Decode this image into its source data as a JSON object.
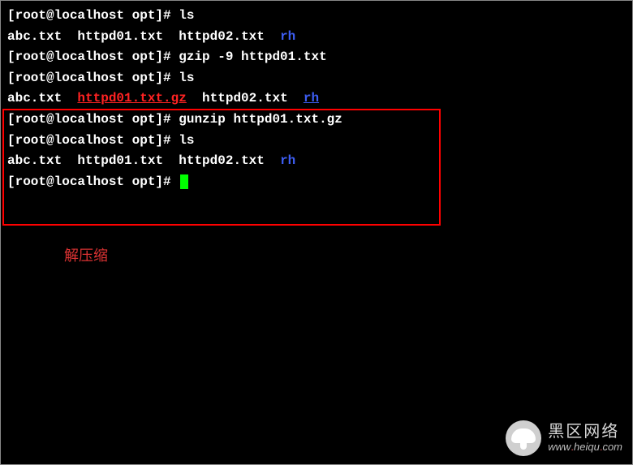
{
  "terminal": {
    "lines": [
      {
        "prompt": "[root@localhost opt]# ",
        "cmd": "ls"
      },
      {
        "files": [
          {
            "name": "abc.txt",
            "cls": "white"
          },
          {
            "gap": "  "
          },
          {
            "name": "httpd01.txt",
            "cls": "white"
          },
          {
            "gap": "  "
          },
          {
            "name": "httpd02.txt",
            "cls": "white"
          },
          {
            "gap": "  "
          },
          {
            "name": "rh",
            "cls": "blue"
          }
        ]
      },
      {
        "prompt": "[root@localhost opt]# ",
        "cmd": "gzip -9 httpd01.txt"
      },
      {
        "prompt": "[root@localhost opt]# ",
        "cmd": "ls"
      },
      {
        "files": [
          {
            "name": "abc.txt",
            "cls": "white"
          },
          {
            "gap": "  "
          },
          {
            "name": "httpd01.txt.gz",
            "cls": "red-underline"
          },
          {
            "gap": "  "
          },
          {
            "name": "httpd02.txt",
            "cls": "white"
          },
          {
            "gap": "  "
          },
          {
            "name": "rh",
            "cls": "blue-underline"
          }
        ]
      },
      {
        "prompt": "[root@localhost opt]# ",
        "cmd": "gunzip httpd01.txt.gz"
      },
      {
        "prompt": "[root@localhost opt]# ",
        "cmd": "ls"
      },
      {
        "files": [
          {
            "name": "abc.txt",
            "cls": "white"
          },
          {
            "gap": "  "
          },
          {
            "name": "httpd01.txt",
            "cls": "white"
          },
          {
            "gap": "  "
          },
          {
            "name": "httpd02.txt",
            "cls": "white"
          },
          {
            "gap": "  "
          },
          {
            "name": "rh",
            "cls": "blue"
          }
        ]
      },
      {
        "prompt": "[root@localhost opt]# ",
        "cursor": true
      }
    ]
  },
  "annotation": {
    "text": "解压缩"
  },
  "watermark": {
    "title": "黑区网络",
    "url_prefix": "www",
    "url_mid": "heiqu",
    "url_suffix": "com",
    "dot": "."
  }
}
